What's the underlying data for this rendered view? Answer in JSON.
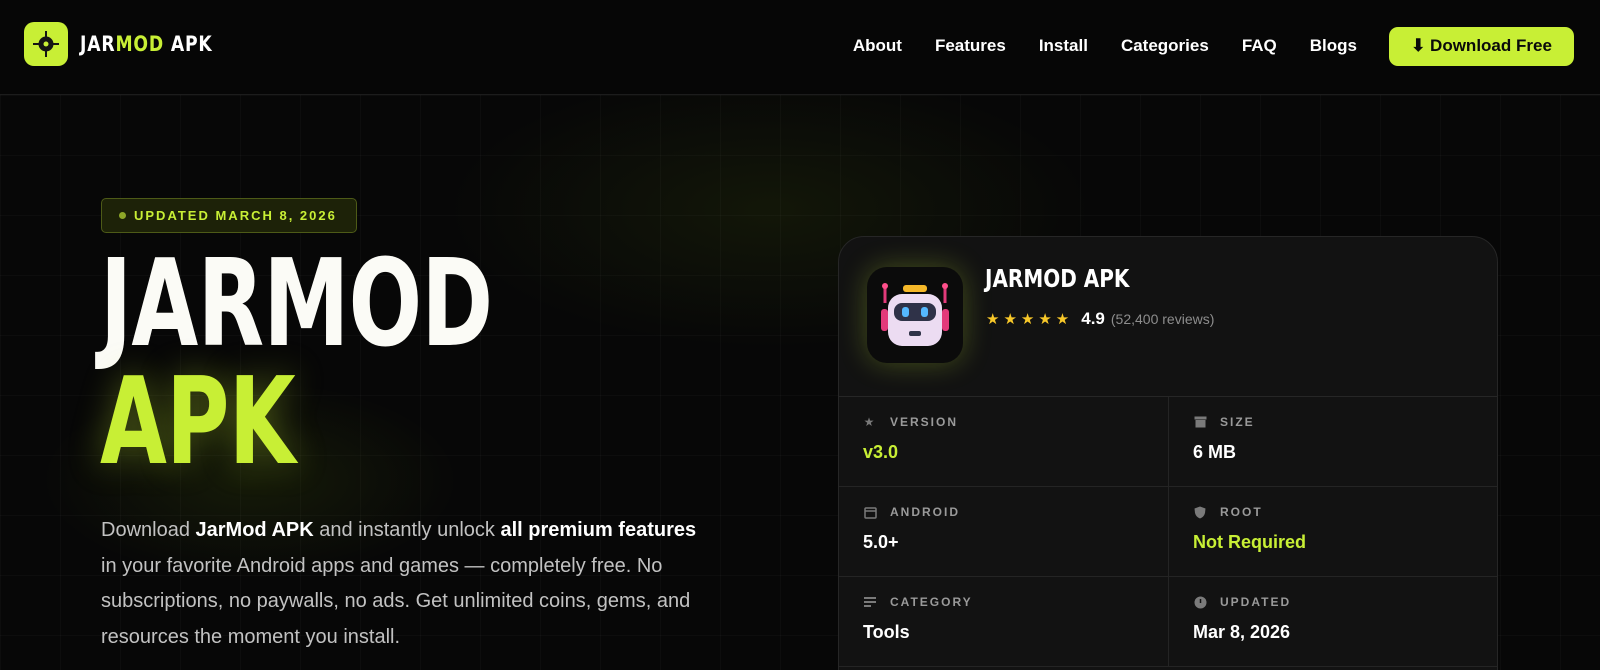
{
  "brand": {
    "name_prefix": "JAR",
    "name_accent": "MOD",
    "name_suffix": " APK"
  },
  "nav": {
    "items": [
      "About",
      "Features",
      "Install",
      "Categories",
      "FAQ",
      "Blogs"
    ],
    "cta_label": "⬇ Download Free"
  },
  "hero": {
    "badge": "UPDATED MARCH 8, 2026",
    "title_line1": "JARMOD",
    "title_line2": "APK",
    "desc": {
      "p1": "Download ",
      "b1": "JarMod APK",
      "p2": " and instantly unlock ",
      "b2": "all premium features",
      "p3": " in your favorite Android apps and games — completely free. No subscriptions, no paywalls, no ads. Get unlimited coins, gems, and resources the moment you install."
    }
  },
  "card": {
    "app_name": "JARMOD APK",
    "stars": "★★★★★",
    "rating": "4.9",
    "reviews": "(52,400 reviews)",
    "info": [
      {
        "label": "VERSION",
        "value": "v3.0",
        "icon": "star-icon",
        "lime": true
      },
      {
        "label": "SIZE",
        "value": "6 MB",
        "icon": "archive-icon",
        "lime": false
      },
      {
        "label": "ANDROID",
        "value": "5.0+",
        "icon": "calendar-icon",
        "lime": false
      },
      {
        "label": "ROOT",
        "value": "Not Required",
        "icon": "shield-icon",
        "lime": true
      },
      {
        "label": "CATEGORY",
        "value": "Tools",
        "icon": "list-icon",
        "lime": false
      },
      {
        "label": "UPDATED",
        "value": "Mar 8, 2026",
        "icon": "clock-icon",
        "lime": false
      }
    ]
  },
  "colors": {
    "accent": "#c8ef35",
    "background": "#070707",
    "card": "#121212",
    "star": "#f8c829"
  }
}
